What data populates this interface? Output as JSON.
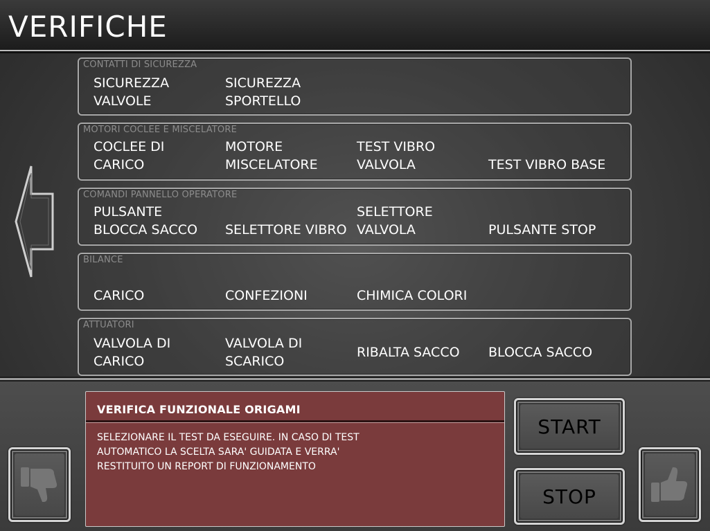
{
  "header": {
    "title": "VERIFICHE"
  },
  "sections": [
    {
      "title": "CONTATTI DI SICUREZZA",
      "items": [
        {
          "line1": "SICUREZZA",
          "line2": "VALVOLE"
        },
        {
          "line1": "SICUREZZA",
          "line2": "SPORTELLO"
        }
      ]
    },
    {
      "title": "MOTORI COCLEE E MISCELATORE",
      "items": [
        {
          "line1": "COCLEE DI",
          "line2": "CARICO"
        },
        {
          "line1": "MOTORE",
          "line2": "MISCELATORE"
        },
        {
          "line1": "TEST VIBRO",
          "line2": "VALVOLA"
        },
        {
          "line1": "",
          "line2": "TEST VIBRO BASE"
        }
      ]
    },
    {
      "title": "COMANDI PANNELLO OPERATORE",
      "items": [
        {
          "line1": "PULSANTE",
          "line2": "BLOCCA SACCO"
        },
        {
          "line1": "",
          "line2": "SELETTORE VIBRO"
        },
        {
          "line1": "SELETTORE",
          "line2": "VALVOLA"
        },
        {
          "line1": "",
          "line2": "PULSANTE STOP"
        }
      ]
    },
    {
      "title": "BILANCE",
      "items": [
        {
          "line1": "",
          "line2": "CARICO"
        },
        {
          "line1": "",
          "line2": "CONFEZIONI"
        },
        {
          "line1": "",
          "line2": "CHIMICA COLORI"
        }
      ]
    },
    {
      "title": "ATTUATORI",
      "items": [
        {
          "line1": "VALVOLA DI",
          "line2": "CARICO"
        },
        {
          "line1": "VALVOLA DI",
          "line2": "SCARICO"
        },
        {
          "line1": "RIBALTA SACCO",
          "line2": ""
        },
        {
          "line1": "BLOCCA SACCO",
          "line2": ""
        }
      ]
    }
  ],
  "message": {
    "title": "VERIFICA FUNZIONALE ORIGAMI",
    "body_lines": [
      "SELEZIONARE IL TEST DA ESEGUIRE. IN CASO DI TEST",
      "AUTOMATICO LA SCELTA SARA' GUIDATA E VERRA'",
      "RESTITUITO UN REPORT DI FUNZIONAMENTO"
    ]
  },
  "buttons": {
    "start_label": "START",
    "stop_label": "STOP"
  },
  "icons": {
    "back": "left-arrow-icon",
    "reject": "thumbs-down-icon",
    "confirm": "thumbs-up-icon"
  },
  "colors": {
    "message_background": "#7a3b3c",
    "section_title": "#8c8c8c"
  }
}
